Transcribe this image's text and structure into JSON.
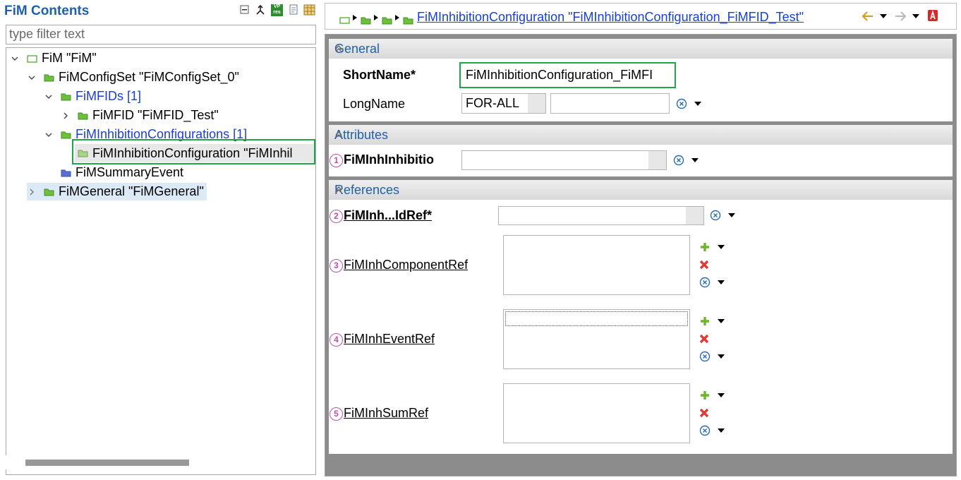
{
  "left": {
    "title": "FiM Contents",
    "filter_placeholder": "type filter text",
    "toolbar_icons": [
      "collapse-all-icon",
      "link-icon",
      "vp-res-icon",
      "document-icon",
      "table-icon"
    ],
    "toolbar_icon_texts": {
      "vp_top": "VP",
      "vp_bottom": "res"
    },
    "tree": [
      {
        "label": "FiM \"FiM\"",
        "expanded": true
      },
      {
        "label": "FiMConfigSet \"FiMConfigSet_0\"",
        "expanded": true
      },
      {
        "label": "FiMFIDs [1]",
        "expanded": true
      },
      {
        "label": "FiMFID \"FiMFID_Test\"",
        "expanded": false
      },
      {
        "label": "FiMInhibitionConfigurations [1]",
        "expanded": true
      },
      {
        "label": "FiMInhibitionConfiguration \"FiMInhil",
        "selected": true
      },
      {
        "label": "FiMSummaryEvent"
      },
      {
        "label": "FiMGeneral \"FiMGeneral\"",
        "expanded": false
      }
    ]
  },
  "breadcrumb": {
    "link": "FiMInhibitionConfiguration \"FiMInhibitionConfiguration_FiMFID_Test\""
  },
  "editor": {
    "sections": {
      "general": "General",
      "attributes": "Attributes",
      "references": "References"
    },
    "shortname_label": "ShortName*",
    "shortname_value": "FiMInhibitionConfiguration_FiMFI",
    "longname_label": "LongName",
    "longname_lang": "FOR-ALL",
    "longname_value": "",
    "attributes": [
      {
        "badge": "1",
        "label": "FiMInhInhibitio",
        "value": ""
      }
    ],
    "references": [
      {
        "badge": "2",
        "label": "FiMInh...IdRef*",
        "value": ""
      },
      {
        "badge": "3",
        "label": "FiMInhComponentRef",
        "items": []
      },
      {
        "badge": "4",
        "label": "FiMInhEventRef",
        "items": [
          ""
        ]
      },
      {
        "badge": "5",
        "label": "FiMInhSumRef",
        "items": []
      }
    ]
  },
  "colors": {
    "accent": "#1f5fb0",
    "highlight": "#1fa64a",
    "link": "#1a3fd6",
    "badge": "#c050a8",
    "folder": "#6fbf3f"
  }
}
